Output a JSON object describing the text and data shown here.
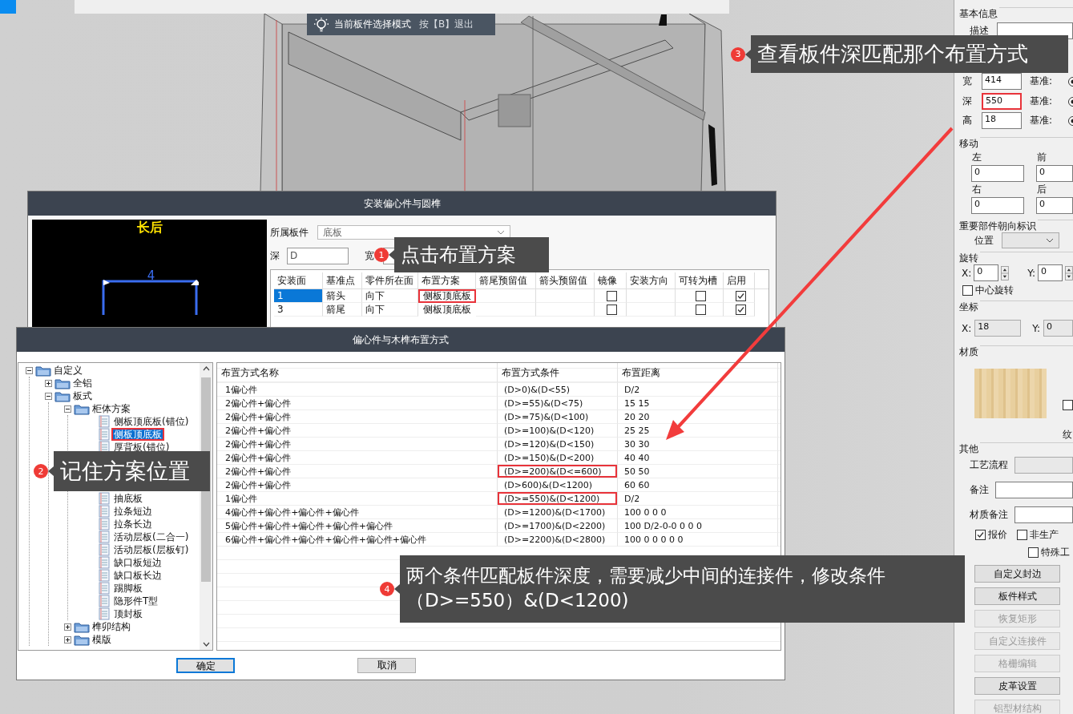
{
  "viewport": {
    "hint": {
      "text": "当前板件选择模式",
      "shortcut": "按【B】退出"
    }
  },
  "install_dialog": {
    "title": "安装偏心件与圆榫",
    "preview": {
      "caption": "长后",
      "dimension": "4"
    },
    "board": {
      "label": "所属板件",
      "value": "底板"
    },
    "depth": {
      "label": "深",
      "value": "D"
    },
    "width": {
      "label": "宽"
    },
    "columns": [
      "安装面",
      "基准点",
      "零件所在面",
      "布置方案",
      "箭尾预留值",
      "箭头预留值",
      "镜像",
      "安装方向",
      "可转为槽",
      "启用"
    ],
    "rows": [
      {
        "face": "1",
        "base": "箭头",
        "side": "向下",
        "scheme": "侧板顶底板",
        "marked": true,
        "mirror": false,
        "slot": false,
        "enabled": true,
        "selected": true
      },
      {
        "face": "3",
        "base": "箭尾",
        "side": "向下",
        "scheme": "侧板顶底板",
        "marked": false,
        "mirror": false,
        "slot": false,
        "enabled": true,
        "selected": false
      }
    ]
  },
  "layout_dialog": {
    "title": "偏心件与木榫布置方式",
    "tree": [
      {
        "label": "自定义",
        "kind": "folder",
        "expanded": true,
        "children": [
          {
            "label": "全铝",
            "kind": "folder",
            "expanded": false
          },
          {
            "label": "板式",
            "kind": "folder",
            "expanded": true,
            "children": [
              {
                "label": "柜体方案",
                "kind": "folder",
                "expanded": true,
                "children": [
                  {
                    "label": "侧板顶底板(错位)",
                    "kind": "scheme",
                    "selected": false,
                    "marked": false
                  },
                  {
                    "label": "侧板顶底板",
                    "kind": "scheme",
                    "selected": true,
                    "marked": true
                  },
                  {
                    "label": "厚背板(错位)",
                    "kind": "scheme",
                    "selected": false,
                    "marked": false
                  },
                  {
                    "kind": "scheme"
                  },
                  {
                    "kind": "scheme"
                  },
                  {
                    "kind": "scheme"
                  },
                  {
                    "label": "抽底板",
                    "kind": "scheme",
                    "selected": false,
                    "marked": false
                  },
                  {
                    "label": "拉条短边",
                    "kind": "scheme",
                    "selected": false,
                    "marked": false
                  },
                  {
                    "label": "拉条长边",
                    "kind": "scheme",
                    "selected": false,
                    "marked": false
                  },
                  {
                    "label": "活动层板(二合一)",
                    "kind": "scheme",
                    "selected": false,
                    "marked": false
                  },
                  {
                    "label": "活动层板(层板钉)",
                    "kind": "scheme",
                    "selected": false,
                    "marked": false
                  },
                  {
                    "label": "缺口板短边",
                    "kind": "scheme",
                    "selected": false,
                    "marked": false
                  },
                  {
                    "label": "缺口板长边",
                    "kind": "scheme",
                    "selected": false,
                    "marked": false
                  },
                  {
                    "label": "踢脚板",
                    "kind": "scheme",
                    "selected": false,
                    "marked": false
                  },
                  {
                    "label": "隐形件T型",
                    "kind": "scheme",
                    "selected": false,
                    "marked": false
                  },
                  {
                    "label": "顶封板",
                    "kind": "scheme",
                    "selected": false,
                    "marked": false
                  }
                ]
              },
              {
                "label": "榫卯结构",
                "kind": "folder",
                "expanded": false
              },
              {
                "label": "模版",
                "kind": "folder",
                "expanded": false
              }
            ]
          }
        ]
      }
    ],
    "columns": [
      "布置方式名称",
      "布置方式条件",
      "布置距离"
    ],
    "rows": [
      {
        "name": "1偏心件",
        "condition": "(D>0)&(D<55)",
        "distance": "D/2",
        "marked": false
      },
      {
        "name": "2偏心件+偏心件",
        "condition": "(D>=55)&(D<75)",
        "distance": "15 15",
        "marked": false
      },
      {
        "name": "2偏心件+偏心件",
        "condition": "(D>=75)&(D<100)",
        "distance": "20 20",
        "marked": false
      },
      {
        "name": "2偏心件+偏心件",
        "condition": "(D>=100)&(D<120)",
        "distance": "25 25",
        "marked": false
      },
      {
        "name": "2偏心件+偏心件",
        "condition": "(D>=120)&(D<150)",
        "distance": "30 30",
        "marked": false
      },
      {
        "name": "2偏心件+偏心件",
        "condition": "(D>=150)&(D<200)",
        "distance": "40 40",
        "marked": false
      },
      {
        "name": "2偏心件+偏心件",
        "condition": "(D>=200)&(D<=600)",
        "distance": "50 50",
        "marked": true
      },
      {
        "name": "2偏心件+偏心件",
        "condition": "(D>600)&(D<1200)",
        "distance": "60 60",
        "marked": false
      },
      {
        "name": "1偏心件",
        "condition": "(D>=550)&(D<1200)",
        "distance": "D/2",
        "marked": true
      },
      {
        "name": "4偏心件+偏心件+偏心件+偏心件",
        "condition": "(D>=1200)&(D<1700)",
        "distance": "100 0 0 0",
        "marked": false
      },
      {
        "name": "5偏心件+偏心件+偏心件+偏心件+偏心件",
        "condition": "(D>=1700)&(D<2200)",
        "distance": "100 D/2-0-0 0 0 0",
        "marked": false
      },
      {
        "name": "6偏心件+偏心件+偏心件+偏心件+偏心件+偏心件",
        "condition": "(D>=2200)&(D<2800)",
        "distance": "100 0 0 0 0 0",
        "marked": false
      }
    ],
    "buttons": [
      {
        "label": "确定",
        "default": true
      },
      {
        "label": "取消",
        "default": false
      }
    ]
  },
  "properties": {
    "basic": {
      "title": "基本信息",
      "description_label": "描述",
      "dims": [
        {
          "label": "宽",
          "value": "414",
          "ref": "基准:",
          "ref_selected": true,
          "marked": false
        },
        {
          "label": "深",
          "value": "550",
          "ref": "基准:",
          "ref_selected": true,
          "marked": true
        },
        {
          "label": "高",
          "value": "18",
          "ref": "基准:",
          "ref_selected": true,
          "marked": false
        }
      ]
    },
    "move": {
      "title": "移动",
      "fields": [
        {
          "label": "左",
          "value": "0"
        },
        {
          "label": "前",
          "value": "0"
        },
        {
          "label": "右",
          "value": "0"
        },
        {
          "label": "后",
          "value": "0"
        }
      ]
    },
    "orientation": {
      "title": "重要部件朝向标识",
      "label": "位置"
    },
    "rotation": {
      "title": "旋转",
      "x": {
        "label": "X:",
        "value": "0"
      },
      "y": {
        "label": "Y:",
        "value": "0"
      },
      "center": {
        "label": "中心旋转",
        "checked": false
      }
    },
    "coords": {
      "title": "坐标",
      "x": {
        "label": "X:",
        "value": "18"
      },
      "y": {
        "label": "Y:",
        "value": "0"
      }
    },
    "material": {
      "title": "材质",
      "check": {
        "checked": false
      },
      "note": "纹"
    },
    "other": {
      "title": "其他",
      "fields": [
        {
          "label": "工艺流程",
          "disabled": true
        },
        {
          "label": "备注",
          "disabled": false
        },
        {
          "label": "材质备注",
          "disabled": false
        }
      ],
      "checks": [
        {
          "label": "报价",
          "checked": true
        },
        {
          "label": "非生产",
          "checked": false
        },
        {
          "label": "特殊工",
          "checked": false
        }
      ],
      "buttons": [
        {
          "label": "自定义封边",
          "disabled": false
        },
        {
          "label": "板件样式",
          "disabled": false
        },
        {
          "label": "恢复矩形",
          "disabled": true
        },
        {
          "label": "自定义连接件",
          "disabled": true
        },
        {
          "label": "格栅编辑",
          "disabled": true
        },
        {
          "label": "皮革设置",
          "disabled": false
        },
        {
          "label": "铝型材结构",
          "disabled": true
        }
      ]
    }
  },
  "callouts": [
    {
      "number": "1",
      "lines": [
        "点击布置方案"
      ]
    },
    {
      "number": "2",
      "lines": [
        "记住方案位置"
      ]
    },
    {
      "number": "3",
      "lines": [
        "查看板件深匹配那个布置方式"
      ]
    },
    {
      "number": "4",
      "lines": [
        "两个条件匹配板件深度，需要减少中间的连接件，修改条件",
        "（D>=550）&(D<1200)"
      ]
    }
  ]
}
